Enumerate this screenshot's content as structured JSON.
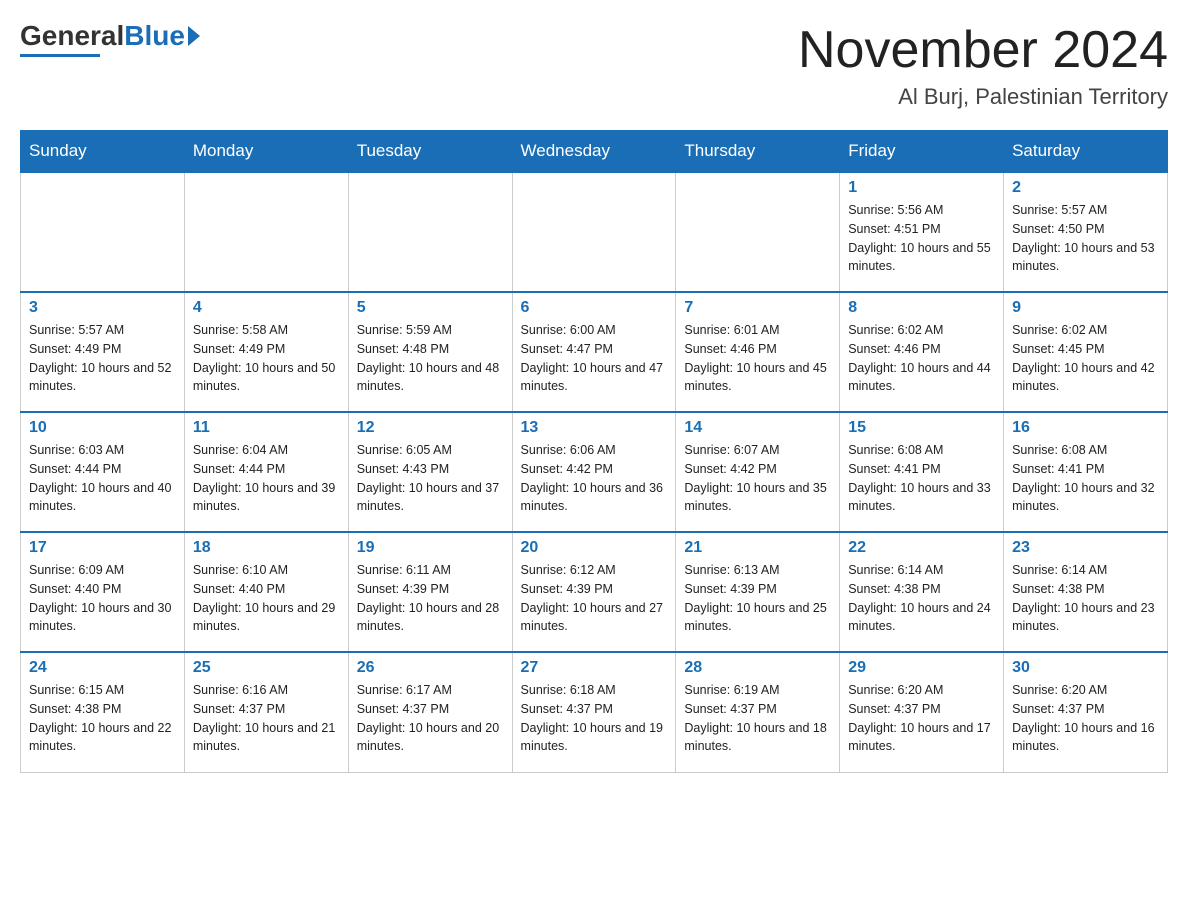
{
  "header": {
    "logo_general": "General",
    "logo_blue": "Blue",
    "title": "November 2024",
    "subtitle": "Al Burj, Palestinian Territory"
  },
  "days_of_week": [
    "Sunday",
    "Monday",
    "Tuesday",
    "Wednesday",
    "Thursday",
    "Friday",
    "Saturday"
  ],
  "weeks": [
    [
      {
        "day": "",
        "info": ""
      },
      {
        "day": "",
        "info": ""
      },
      {
        "day": "",
        "info": ""
      },
      {
        "day": "",
        "info": ""
      },
      {
        "day": "",
        "info": ""
      },
      {
        "day": "1",
        "info": "Sunrise: 5:56 AM\nSunset: 4:51 PM\nDaylight: 10 hours and 55 minutes."
      },
      {
        "day": "2",
        "info": "Sunrise: 5:57 AM\nSunset: 4:50 PM\nDaylight: 10 hours and 53 minutes."
      }
    ],
    [
      {
        "day": "3",
        "info": "Sunrise: 5:57 AM\nSunset: 4:49 PM\nDaylight: 10 hours and 52 minutes."
      },
      {
        "day": "4",
        "info": "Sunrise: 5:58 AM\nSunset: 4:49 PM\nDaylight: 10 hours and 50 minutes."
      },
      {
        "day": "5",
        "info": "Sunrise: 5:59 AM\nSunset: 4:48 PM\nDaylight: 10 hours and 48 minutes."
      },
      {
        "day": "6",
        "info": "Sunrise: 6:00 AM\nSunset: 4:47 PM\nDaylight: 10 hours and 47 minutes."
      },
      {
        "day": "7",
        "info": "Sunrise: 6:01 AM\nSunset: 4:46 PM\nDaylight: 10 hours and 45 minutes."
      },
      {
        "day": "8",
        "info": "Sunrise: 6:02 AM\nSunset: 4:46 PM\nDaylight: 10 hours and 44 minutes."
      },
      {
        "day": "9",
        "info": "Sunrise: 6:02 AM\nSunset: 4:45 PM\nDaylight: 10 hours and 42 minutes."
      }
    ],
    [
      {
        "day": "10",
        "info": "Sunrise: 6:03 AM\nSunset: 4:44 PM\nDaylight: 10 hours and 40 minutes."
      },
      {
        "day": "11",
        "info": "Sunrise: 6:04 AM\nSunset: 4:44 PM\nDaylight: 10 hours and 39 minutes."
      },
      {
        "day": "12",
        "info": "Sunrise: 6:05 AM\nSunset: 4:43 PM\nDaylight: 10 hours and 37 minutes."
      },
      {
        "day": "13",
        "info": "Sunrise: 6:06 AM\nSunset: 4:42 PM\nDaylight: 10 hours and 36 minutes."
      },
      {
        "day": "14",
        "info": "Sunrise: 6:07 AM\nSunset: 4:42 PM\nDaylight: 10 hours and 35 minutes."
      },
      {
        "day": "15",
        "info": "Sunrise: 6:08 AM\nSunset: 4:41 PM\nDaylight: 10 hours and 33 minutes."
      },
      {
        "day": "16",
        "info": "Sunrise: 6:08 AM\nSunset: 4:41 PM\nDaylight: 10 hours and 32 minutes."
      }
    ],
    [
      {
        "day": "17",
        "info": "Sunrise: 6:09 AM\nSunset: 4:40 PM\nDaylight: 10 hours and 30 minutes."
      },
      {
        "day": "18",
        "info": "Sunrise: 6:10 AM\nSunset: 4:40 PM\nDaylight: 10 hours and 29 minutes."
      },
      {
        "day": "19",
        "info": "Sunrise: 6:11 AM\nSunset: 4:39 PM\nDaylight: 10 hours and 28 minutes."
      },
      {
        "day": "20",
        "info": "Sunrise: 6:12 AM\nSunset: 4:39 PM\nDaylight: 10 hours and 27 minutes."
      },
      {
        "day": "21",
        "info": "Sunrise: 6:13 AM\nSunset: 4:39 PM\nDaylight: 10 hours and 25 minutes."
      },
      {
        "day": "22",
        "info": "Sunrise: 6:14 AM\nSunset: 4:38 PM\nDaylight: 10 hours and 24 minutes."
      },
      {
        "day": "23",
        "info": "Sunrise: 6:14 AM\nSunset: 4:38 PM\nDaylight: 10 hours and 23 minutes."
      }
    ],
    [
      {
        "day": "24",
        "info": "Sunrise: 6:15 AM\nSunset: 4:38 PM\nDaylight: 10 hours and 22 minutes."
      },
      {
        "day": "25",
        "info": "Sunrise: 6:16 AM\nSunset: 4:37 PM\nDaylight: 10 hours and 21 minutes."
      },
      {
        "day": "26",
        "info": "Sunrise: 6:17 AM\nSunset: 4:37 PM\nDaylight: 10 hours and 20 minutes."
      },
      {
        "day": "27",
        "info": "Sunrise: 6:18 AM\nSunset: 4:37 PM\nDaylight: 10 hours and 19 minutes."
      },
      {
        "day": "28",
        "info": "Sunrise: 6:19 AM\nSunset: 4:37 PM\nDaylight: 10 hours and 18 minutes."
      },
      {
        "day": "29",
        "info": "Sunrise: 6:20 AM\nSunset: 4:37 PM\nDaylight: 10 hours and 17 minutes."
      },
      {
        "day": "30",
        "info": "Sunrise: 6:20 AM\nSunset: 4:37 PM\nDaylight: 10 hours and 16 minutes."
      }
    ]
  ]
}
